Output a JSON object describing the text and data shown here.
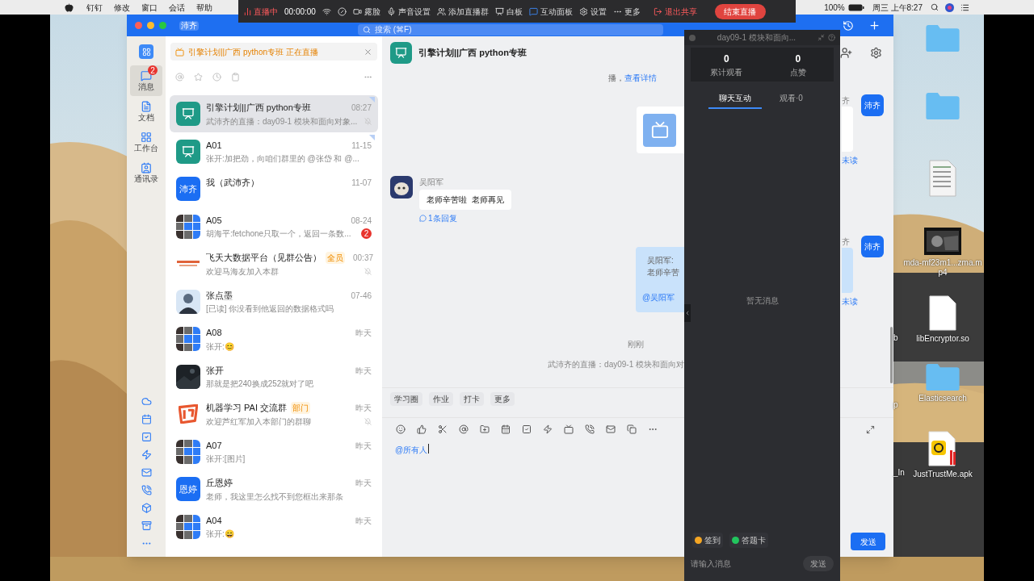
{
  "menu_bar": {
    "app_menus": [
      "钉钉",
      "修改",
      "窗口",
      "会话",
      "帮助"
    ],
    "battery": "100%",
    "clock": "周三 上午8:27"
  },
  "live_toolbar": {
    "status": "直播中",
    "timer": "00:00:00",
    "items": [
      {
        "label": "露脸"
      },
      {
        "label": "声音设置"
      },
      {
        "label": "添加直播群"
      },
      {
        "label": "白板"
      },
      {
        "label": "互动面板"
      },
      {
        "label": "设置"
      },
      {
        "label": "更多"
      }
    ],
    "exit_share": "退出共享",
    "end_button": "结束直播"
  },
  "window": {
    "app_badge": "沛齐",
    "search_placeholder": "搜索 (⌘F)"
  },
  "rail": [
    {
      "label": "消息",
      "badge": "2",
      "selected": true
    },
    {
      "label": "文档",
      "selected": false
    },
    {
      "label": "工作台",
      "selected": false
    },
    {
      "label": "通讯录",
      "selected": false
    }
  ],
  "banner": {
    "text": "引擎计划||广西 python专班 正在直播"
  },
  "chats": [
    {
      "name": "引擎计划||广西 python专班",
      "time": "08:27",
      "preview": "武沛齐的直播：day09-1 模块和面向对象...",
      "selected": true,
      "pinned": true,
      "muted": true,
      "avatar": {
        "kind": "group-icon"
      }
    },
    {
      "name": "A01",
      "time": "11-15",
      "preview": "张开:加把劲，向咱们群里的 @张岱 和 @...",
      "selected": false,
      "pinned": true,
      "muted": false,
      "avatar": {
        "kind": "group-icon"
      }
    },
    {
      "name": "我（武沛齐）",
      "time": "11-07",
      "selected": false,
      "pinned": false,
      "muted": false,
      "avatar": {
        "kind": "text",
        "text": "沛齐"
      }
    },
    {
      "name": "A05",
      "time": "08-24",
      "preview": "胡海平:fetchone只取一个，返回一条数...",
      "unread": "2",
      "selected": false,
      "pinned": false,
      "muted": false,
      "avatar": {
        "kind": "mosaic"
      }
    },
    {
      "name": "飞天大数据平台（见群公告）",
      "tag": "全员",
      "time": "00:37",
      "preview": "欢迎马海友加入本群",
      "selected": false,
      "pinned": false,
      "muted": true,
      "avatar": {
        "kind": "logo"
      }
    },
    {
      "name": "张点墨",
      "time": "07-46",
      "preview": "[已读] 你没看到他返回的数据格式吗",
      "selected": false,
      "pinned": false,
      "muted": false,
      "avatar": {
        "kind": "person"
      }
    },
    {
      "name": "A08",
      "time": "昨天",
      "preview": "张开:😊",
      "selected": false,
      "pinned": false,
      "muted": false,
      "avatar": {
        "kind": "mosaic"
      }
    },
    {
      "name": "张开",
      "time": "昨天",
      "preview": "那就是把240换成252就对了吧",
      "selected": false,
      "pinned": false,
      "muted": false
    },
    {
      "name": "机器学习 PAI 交流群",
      "tag": "部门",
      "time": "昨天",
      "preview": "欢迎芦红军加入本部门的群聊",
      "selected": false,
      "pinned": false,
      "muted": true,
      "avatar": {
        "kind": "pai"
      }
    },
    {
      "name": "A07",
      "time": "昨天",
      "preview": "张开:[图片]",
      "selected": false,
      "pinned": false,
      "muted": false,
      "avatar": {
        "kind": "mosaic"
      }
    },
    {
      "name": "丘恩婷",
      "time": "昨天",
      "preview": "老师，我这里怎么找不到您框出来那条",
      "selected": false,
      "pinned": false,
      "muted": false,
      "avatar": {
        "kind": "text",
        "text": "恩婷"
      }
    },
    {
      "name": "A04",
      "time": "昨天",
      "preview": "张开:😄",
      "selected": false,
      "pinned": false,
      "muted": false,
      "avatar": {
        "kind": "mosaic"
      }
    }
  ],
  "chat": {
    "title": "引擎计划||广西 python专班",
    "top_fragment": "播，",
    "top_link": "查看详情",
    "message": {
      "sender": "吴阳军",
      "text": "老师辛苦啦  老师再见",
      "replies": "1条回复"
    },
    "quote": {
      "sender": "吴阳军:",
      "text": "老师辛苦",
      "mention": "@吴阳军"
    },
    "time": "刚刚",
    "system": "武沛齐的直播：day09-1 模块和面向对",
    "right_fragments": [
      {
        "name": "齐",
        "avatar": "沛齐",
        "status": "未读"
      },
      {
        "name": "齐",
        "avatar": "沛齐",
        "status": "未读"
      }
    ],
    "quick_tags": [
      "学习圈",
      "作业",
      "打卡",
      "更多"
    ],
    "input": "@所有人",
    "send": "发送"
  },
  "live_panel": {
    "title": "day09-1 模块和面向...",
    "stats": [
      {
        "value": "0",
        "label": "累计观看"
      },
      {
        "value": "0",
        "label": "点赞"
      }
    ],
    "tabs": [
      {
        "label": "聊天互动",
        "selected": true
      },
      {
        "label": "观看·0",
        "selected": false
      }
    ],
    "empty": "暂无消息",
    "actions": [
      {
        "label": "签到",
        "color": "#f5a623"
      },
      {
        "label": "答题卡",
        "color": "#22c55e"
      }
    ],
    "input_placeholder": "请输入消息",
    "send": "发送"
  },
  "desktop": {
    "icons": [
      {
        "kind": "folder"
      },
      {
        "kind": "folder"
      },
      {
        "kind": "document"
      },
      {
        "kind": "video",
        "label": "mda-mf23m1...zma.mp4"
      },
      {
        "kind": "file",
        "label": "libEncryptor.so"
      },
      {
        "kind": "folder",
        "label": "Elasticsearch"
      },
      {
        "kind": "apk",
        "label": "JustTrustMe.apk"
      }
    ],
    "hidden_label_fragments": [
      "b",
      "p",
      "_In"
    ]
  }
}
